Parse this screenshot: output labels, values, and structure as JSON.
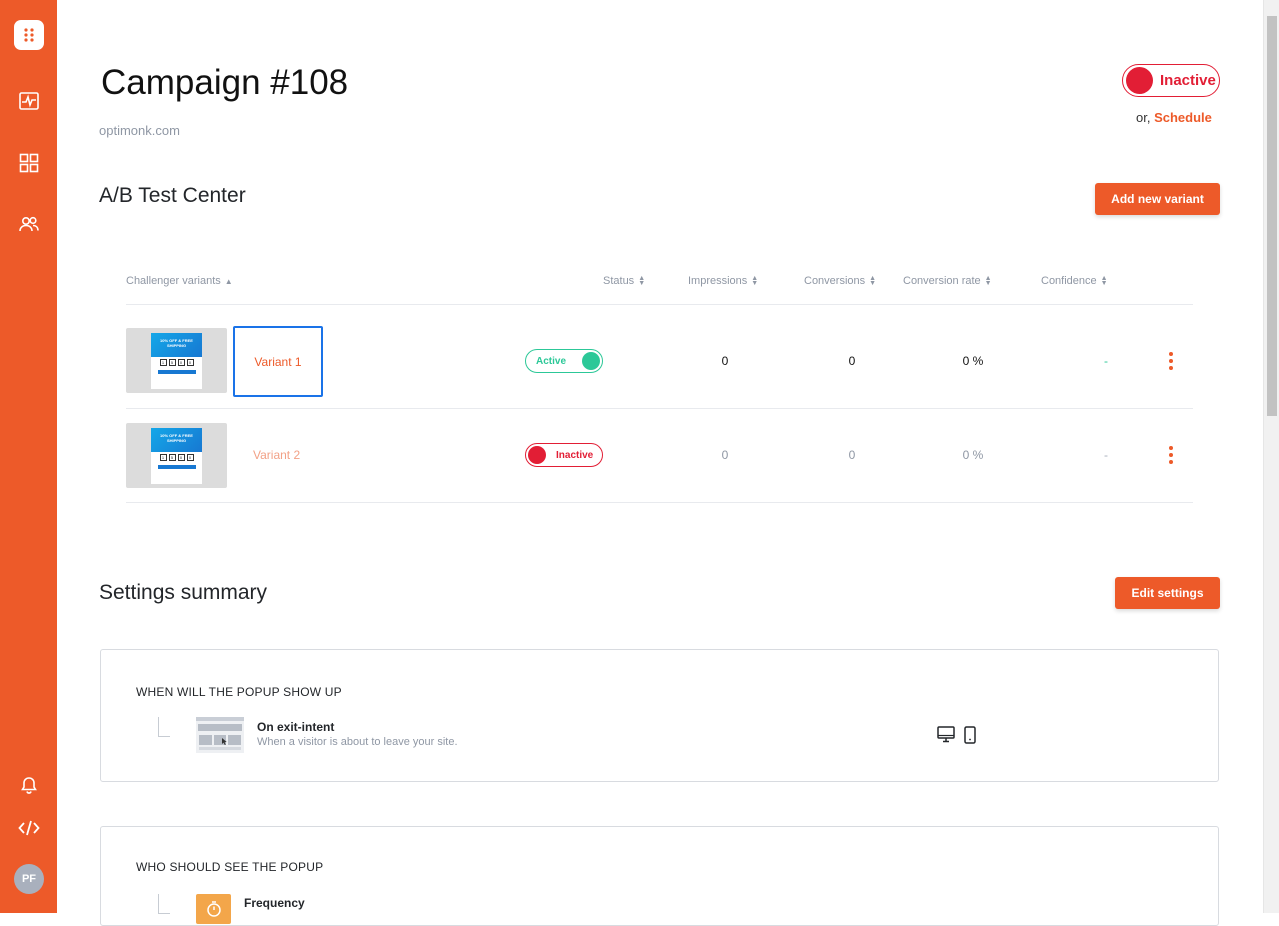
{
  "sidebar": {
    "items": [
      {
        "name": "analytics-icon"
      },
      {
        "name": "dashboard-icon"
      },
      {
        "name": "subscribers-icon"
      },
      {
        "name": "notifications-icon"
      },
      {
        "name": "code-icon"
      }
    ],
    "avatar_initials": "PF"
  },
  "header": {
    "title": "Campaign #108",
    "domain": "optimonk.com",
    "status_label": "Inactive",
    "schedule_prefix": "or,",
    "schedule_link": "Schedule"
  },
  "ab_test": {
    "title": "A/B Test Center",
    "add_button": "Add new variant",
    "columns": [
      "Challenger variants",
      "Status",
      "Impressions",
      "Conversions",
      "Conversion rate",
      "Confidence"
    ],
    "variants": [
      {
        "name": "Variant 1",
        "status": "Active",
        "impressions": "0",
        "conversions": "0",
        "conversion_rate": "0 %",
        "confidence": "-"
      },
      {
        "name": "Variant 2",
        "status": "Inactive",
        "impressions": "0",
        "conversions": "0",
        "conversion_rate": "0 %",
        "confidence": "-"
      }
    ],
    "thumb_headline": "10% OFF & FREE SHIPPING",
    "thumb_digits": [
      "1",
      "5",
      "0",
      "0"
    ]
  },
  "settings": {
    "title": "Settings summary",
    "edit_button": "Edit settings",
    "when_title": "WHEN WILL THE POPUP SHOW UP",
    "trigger_name": "On exit-intent",
    "trigger_desc": "When a visitor is about to leave your site.",
    "who_title": "WHO SHOULD SEE THE POPUP",
    "who_item": "Frequency"
  },
  "colors": {
    "brand": "#ed5a29",
    "active": "#2cc898",
    "inactive": "#e21e35"
  }
}
